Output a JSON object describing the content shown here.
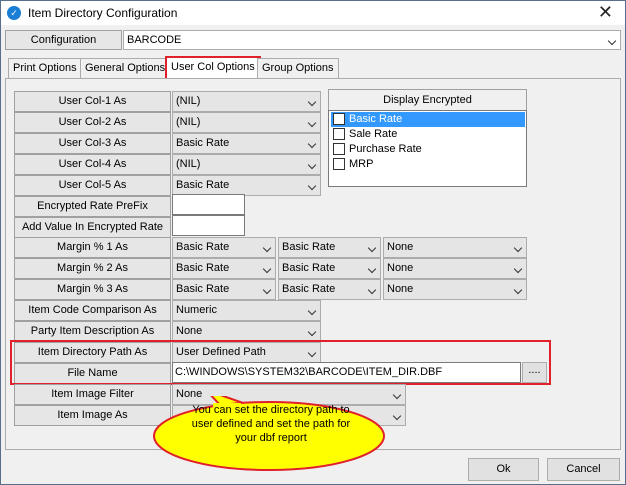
{
  "window": {
    "title": "Item Directory Configuration",
    "app_icon": "app-icon",
    "close_icon": "close-icon"
  },
  "configuration": {
    "label": "Configuration",
    "value": "BARCODE"
  },
  "tabs": [
    {
      "label": "Print Options"
    },
    {
      "label": "General Options"
    },
    {
      "label": "User Col Options",
      "active": true
    },
    {
      "label": "Group Options"
    }
  ],
  "user_cols": [
    {
      "label": "User Col-1 As",
      "value": "(NIL)"
    },
    {
      "label": "User Col-2 As",
      "value": "(NIL)"
    },
    {
      "label": "User Col-3 As",
      "value": "Basic Rate"
    },
    {
      "label": "User Col-4 As",
      "value": "(NIL)"
    },
    {
      "label": "User Col-5 As",
      "value": "Basic Rate"
    }
  ],
  "encrypted": {
    "prefix_label": "Encrypted Rate PreFix",
    "prefix_value": "",
    "add_value_label": "Add Value In Encrypted Rate",
    "add_value_value": ""
  },
  "display_encrypted": {
    "header": "Display Encrypted",
    "items": [
      {
        "label": "Basic Rate",
        "checked": false,
        "selected": true
      },
      {
        "label": "Sale Rate",
        "checked": false
      },
      {
        "label": "Purchase Rate",
        "checked": false
      },
      {
        "label": "MRP",
        "checked": false
      }
    ]
  },
  "margins": [
    {
      "label": "Margin % 1 As",
      "v1": "Basic Rate",
      "v2": "Basic Rate",
      "v3": "None"
    },
    {
      "label": "Margin % 2 As",
      "v1": "Basic Rate",
      "v2": "Basic Rate",
      "v3": "None"
    },
    {
      "label": "Margin % 3 As",
      "v1": "Basic Rate",
      "v2": "Basic Rate",
      "v3": "None"
    }
  ],
  "item_code_comparison": {
    "label": "Item Code Comparison As",
    "value": "Numeric"
  },
  "party_item_desc": {
    "label": "Party Item Description As",
    "value": "None"
  },
  "item_dir_path": {
    "label": "Item Directory Path As",
    "value": "User Defined Path"
  },
  "file_name": {
    "label": "File Name",
    "value": "C:\\WINDOWS\\SYSTEM32\\BARCODE\\ITEM_DIR.DBF",
    "browse_label": "...."
  },
  "item_image_filter": {
    "label": "Item Image Filter",
    "value": "None"
  },
  "item_image_as": {
    "label": "Item Image As",
    "value": ""
  },
  "callout": {
    "text": "You can set the directory path to user defined and set the path for your dbf report"
  },
  "buttons": {
    "ok": "Ok",
    "cancel": "Cancel"
  },
  "colors": {
    "highlight_red": "#e0202a",
    "selection_blue": "#3399ff",
    "callout_fill": "#ffff00"
  }
}
